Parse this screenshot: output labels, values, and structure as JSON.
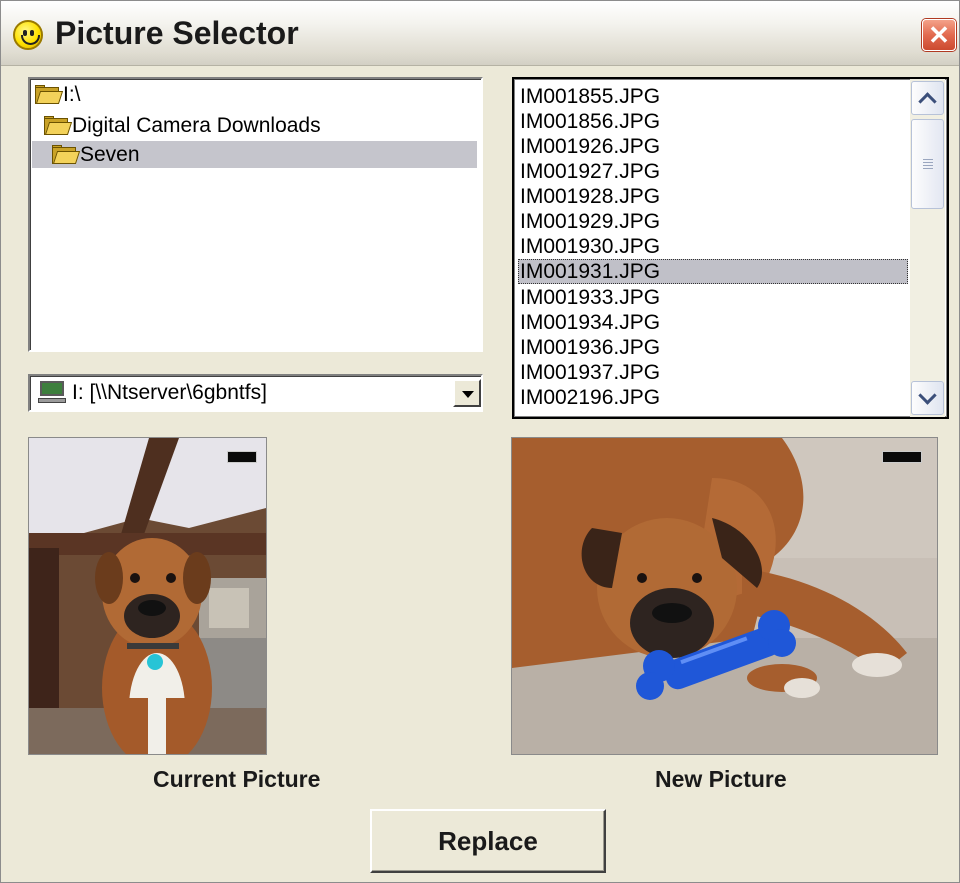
{
  "window": {
    "title": "Picture Selector",
    "close_symbol": "✕"
  },
  "folder_tree": {
    "items": [
      {
        "label": "I:\\",
        "icon": "folder-open-icon"
      },
      {
        "label": "Digital Camera Downloads",
        "icon": "folder-open-icon"
      },
      {
        "label": "Seven",
        "icon": "folder-open-icon",
        "selected": true
      }
    ]
  },
  "drive_select": {
    "value": "I: [\\\\Ntserver\\6gbntfs]",
    "icon": "network-drive-icon"
  },
  "file_list": {
    "items": [
      "IM001855.JPG",
      "IM001856.JPG",
      "IM001926.JPG",
      "IM001927.JPG",
      "IM001928.JPG",
      "IM001929.JPG",
      "IM001930.JPG",
      "IM001931.JPG",
      "IM001933.JPG",
      "IM001934.JPG",
      "IM001936.JPG",
      "IM001937.JPG",
      "IM002196.JPG"
    ],
    "selected": "IM001931.JPG"
  },
  "previews": {
    "current_label": "Current Picture",
    "new_label": "New Picture"
  },
  "actions": {
    "replace_label": "Replace"
  }
}
